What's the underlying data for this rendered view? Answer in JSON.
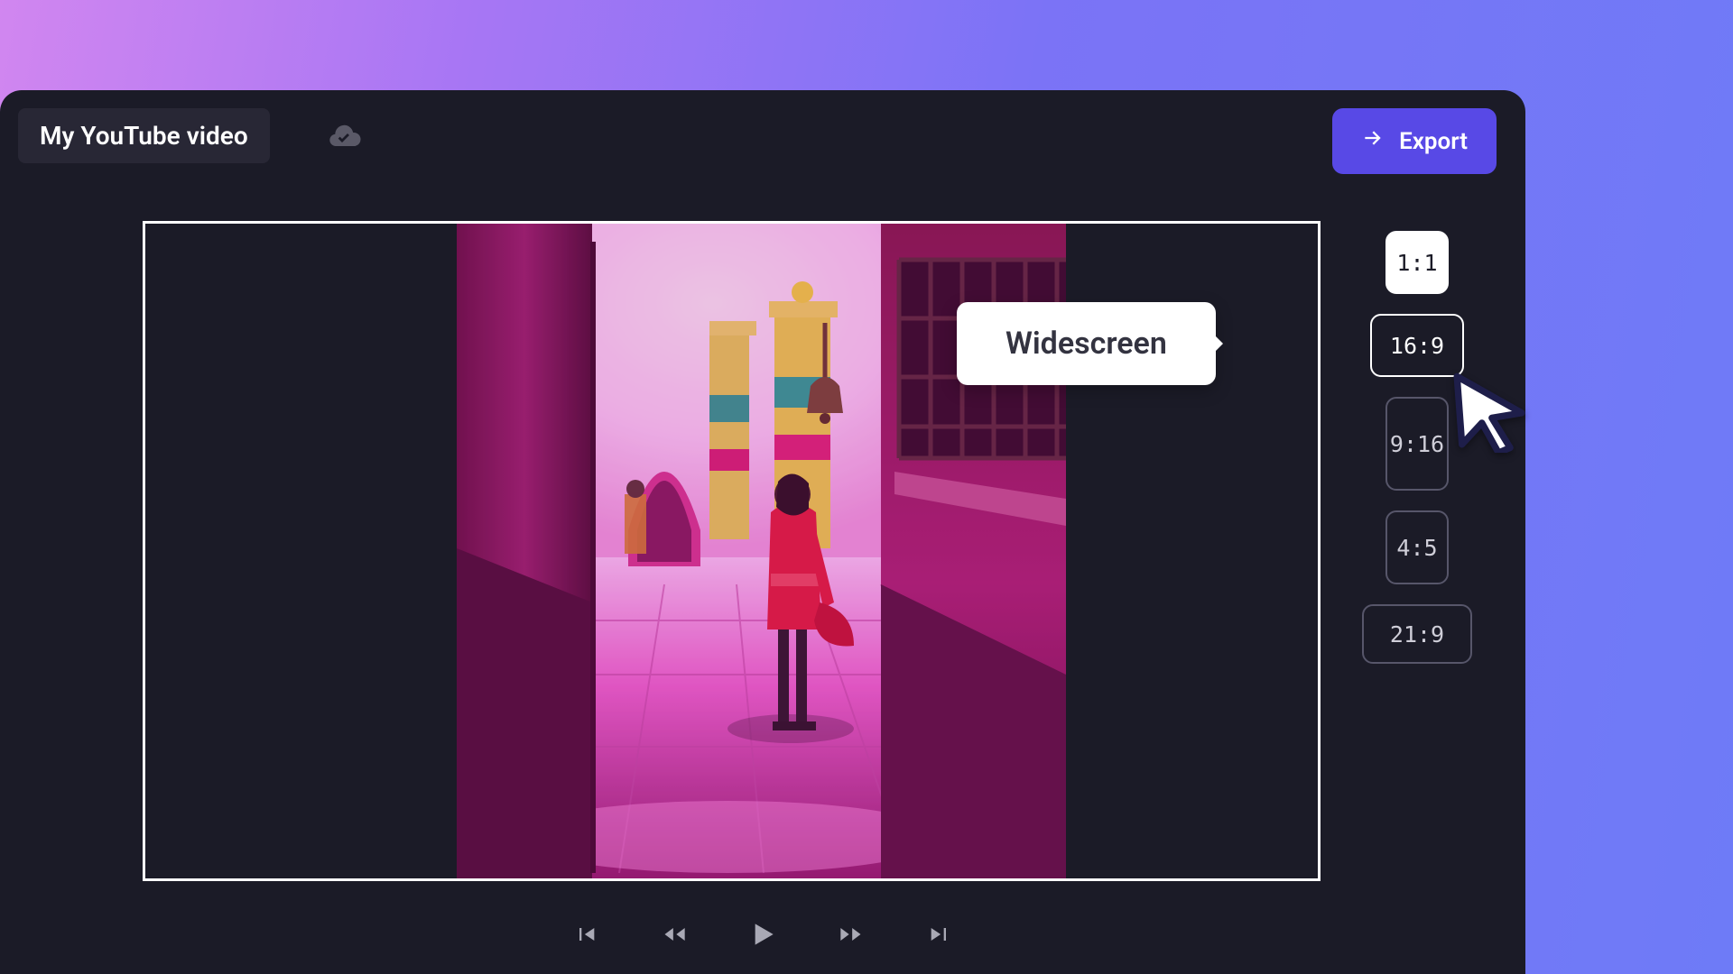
{
  "header": {
    "project_title": "My YouTube video",
    "cloud_status_icon": "cloud-synced",
    "export_label": "Export"
  },
  "tooltip": {
    "label": "Widescreen",
    "target_ratio": "16:9"
  },
  "aspect_ratios": [
    {
      "id": "1:1",
      "label": "1:1",
      "selected": false
    },
    {
      "id": "16:9",
      "label": "16:9",
      "selected": true
    },
    {
      "id": "9:16",
      "label": "9:16",
      "selected": false
    },
    {
      "id": "4:5",
      "label": "4:5",
      "selected": false
    },
    {
      "id": "21:9",
      "label": "21:9",
      "selected": false
    }
  ],
  "playback": {
    "icons": [
      "skip-previous",
      "rewind",
      "play",
      "fast-forward",
      "skip-next"
    ]
  },
  "colors": {
    "background_dark": "#1b1b27",
    "accent_purple": "#5849e6",
    "gradient_from": "#d186f0",
    "gradient_to": "#6e7bf7"
  }
}
